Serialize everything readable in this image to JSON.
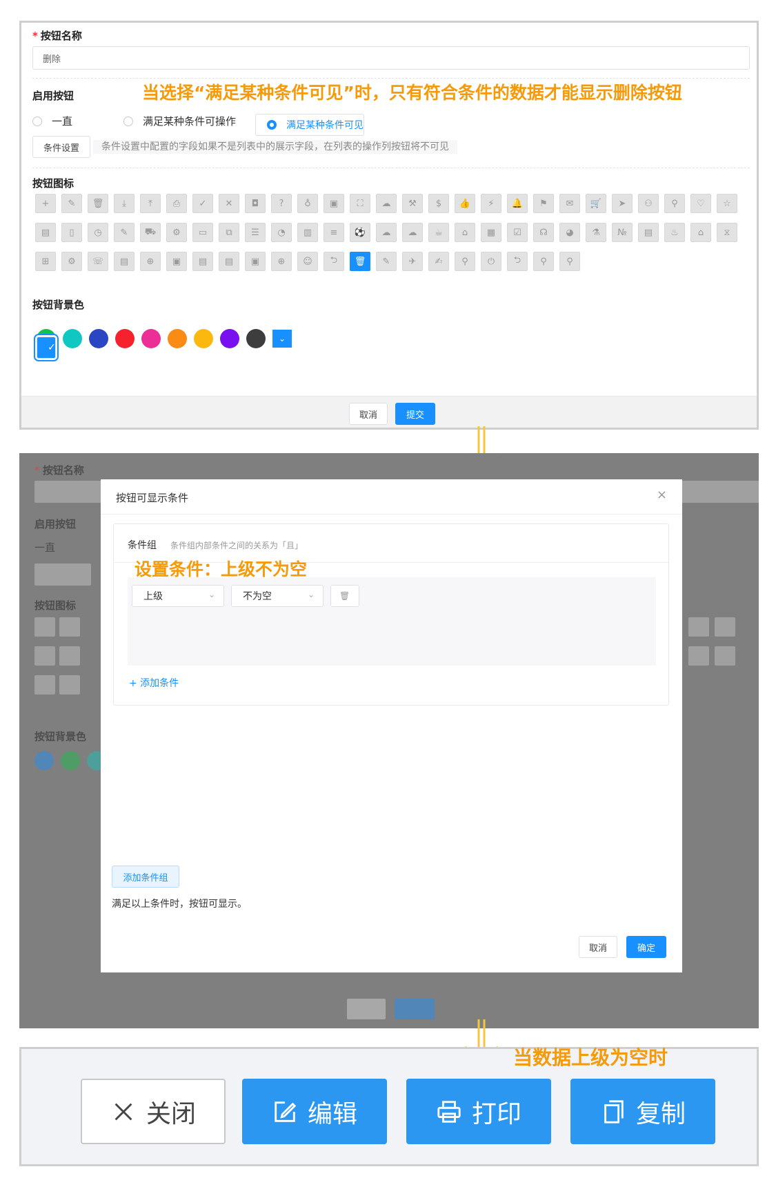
{
  "form": {
    "button_name_label": "按钮名称",
    "required_mark": "*",
    "button_name_value": "删除",
    "enable_label": "启用按钮",
    "radio_options": [
      "一直",
      "满足某种条件可操作",
      "满足某种条件可见"
    ],
    "selected_radio": 2,
    "condition_button": "条件设置",
    "condition_hint": "条件设置中配置的字段如果不是列表中的展示字段，在列表的操作列按钮将不可见",
    "icon_label": "按钮图标",
    "icon_rows": [
      [
        "+",
        "✎",
        "🗑",
        "⤓",
        "⤒",
        "⎙",
        "✓",
        "✕",
        "◘",
        "?",
        "♁",
        "▣",
        "⛶",
        "☁",
        "⚒",
        "$",
        "👍",
        "⚡",
        "🔔",
        "⚑",
        "✉",
        "🛒",
        "➤",
        "⚇",
        "⚲",
        "♡",
        "☆"
      ],
      [
        "▤",
        "▯",
        "◷",
        "✎",
        "⛟",
        "⚙",
        "▭",
        "⧉",
        "☰",
        "◔",
        "▥",
        "≡",
        "⚽",
        "☁",
        "☁",
        "☕",
        "⌂",
        "▦",
        "☑",
        "☊",
        "◕",
        "⚗",
        "№",
        "▤",
        "♨",
        "⌂",
        "⧖"
      ],
      [
        "⊞",
        "⚙",
        "☏",
        "▤",
        "⊕",
        "▣",
        "▤",
        "▤",
        "▣",
        "⊕",
        "☺",
        "⮌",
        "🗑",
        "✎",
        "✈",
        "✍",
        "⚲",
        "⏻",
        "⮌",
        "⚲",
        "⚲"
      ]
    ],
    "selected_icon": {
      "row": 2,
      "col": 12
    },
    "bg_color_label": "按钮背景色",
    "colors": [
      "#1890ff",
      "#13c24b",
      "#11c7c1",
      "#2a46c2",
      "#f5222d",
      "#eb2f96",
      "#fa8c16",
      "#fbb80f",
      "#7a0ff0",
      "#3d3d3d"
    ],
    "selected_color": 0,
    "dropdown_chevron": "⌄",
    "cancel": "取消",
    "submit": "提交"
  },
  "annotations": {
    "top": "当选择“满足某种条件可见”时，只有符合条件的数据才能显示删除按钮",
    "mid": "设置条件：上级不为空",
    "bottom": "当数据上级为空时"
  },
  "modal": {
    "title": "按钮可显示条件",
    "close": "×",
    "group_title": "条件组",
    "group_sub": "条件组内部条件之间的关系为「且」",
    "field": "上级",
    "operator": "不为空",
    "delete_icon": "🗑",
    "add_condition": "+  添加条件",
    "add_group": "添加条件组",
    "note": "满足以上条件时，按钮可显示。",
    "cancel": "取消",
    "ok": "确定"
  },
  "actions": {
    "close": "关闭",
    "edit": "编辑",
    "print": "打印",
    "copy": "复制"
  }
}
